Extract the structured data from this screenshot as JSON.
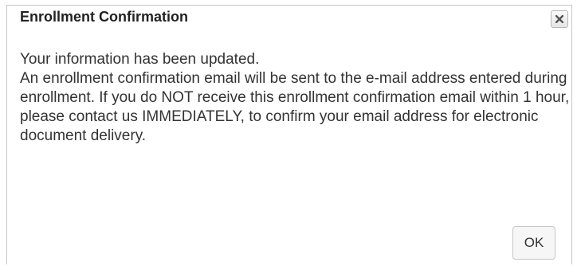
{
  "dialog": {
    "title": "Enrollment Confirmation",
    "message_line1": "Your information has been updated.",
    "message_body": "An enrollment confirmation email will be sent to the e-mail address entered during enrollment. If you do NOT receive this enrollment confirmation email within 1 hour, please contact us IMMEDIATELY, to confirm your email address for electronic document delivery.",
    "ok_label": "OK",
    "close_icon": "close-icon"
  }
}
